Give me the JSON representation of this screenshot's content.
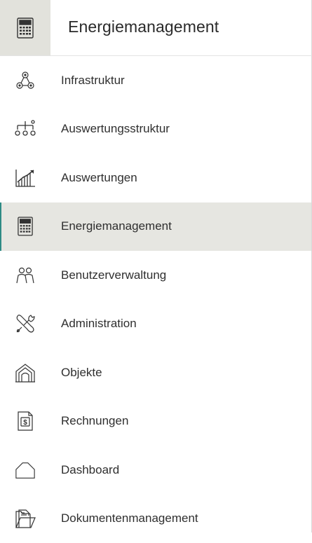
{
  "header": {
    "title": "Energiemanagement",
    "icon": "calculator-icon"
  },
  "menu": {
    "items": [
      {
        "label": "Infrastruktur",
        "icon": "network-nodes-icon",
        "active": false
      },
      {
        "label": "Auswertungsstruktur",
        "icon": "hierarchy-icon",
        "active": false
      },
      {
        "label": "Auswertungen",
        "icon": "bar-chart-icon",
        "active": false
      },
      {
        "label": "Energiemanagement",
        "icon": "calculator-icon",
        "active": true
      },
      {
        "label": "Benutzerverwaltung",
        "icon": "users-icon",
        "active": false
      },
      {
        "label": "Administration",
        "icon": "tools-icon",
        "active": false
      },
      {
        "label": "Objekte",
        "icon": "building-icon",
        "active": false
      },
      {
        "label": "Rechnungen",
        "icon": "invoice-icon",
        "active": false
      },
      {
        "label": "Dashboard",
        "icon": "dashboard-icon",
        "active": false
      },
      {
        "label": "Dokumentenmanagement",
        "icon": "documents-icon",
        "active": false
      }
    ]
  },
  "colors": {
    "active_bg": "#e6e6e1",
    "active_border": "#2e8b85",
    "header_icon_bg": "#e2e2dc",
    "text": "#2f2f2f"
  }
}
